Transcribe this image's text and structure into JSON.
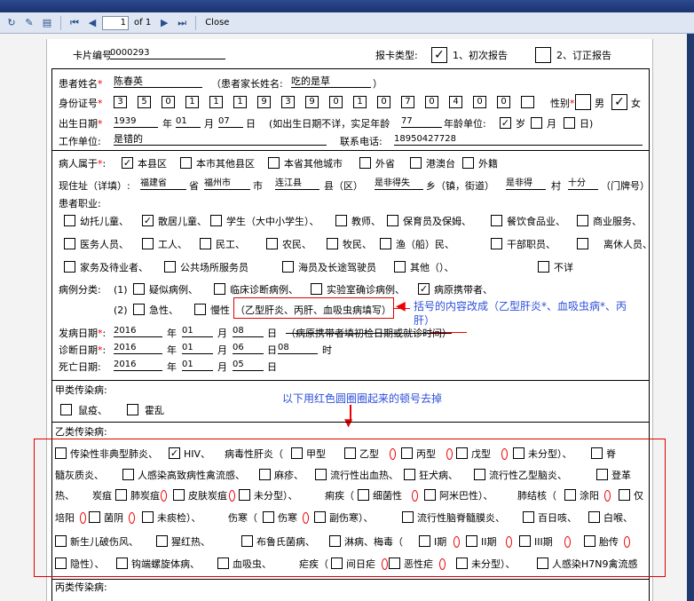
{
  "toolbar": {
    "page": "1",
    "of": "of 1",
    "close": "Close"
  },
  "header": {
    "card_no_label": "卡片编号",
    "card_no": "0000293",
    "type_label": "报卡类型:",
    "type1": "1、初次报告",
    "type2": "2、订正报告"
  },
  "patient": {
    "name_label": "患者姓名",
    "name": "陈春英",
    "parent_label": "（患者家长姓名:",
    "parent": "吃的是草",
    "parent_close": "）",
    "id_label": "身份证号",
    "id_digits": [
      "3",
      "5",
      "0",
      "1",
      "1",
      "1",
      "9",
      "3",
      "9",
      "0",
      "1",
      "0",
      "7",
      "0",
      "4",
      "0",
      "0"
    ],
    "sex_label": "性别",
    "male": "男",
    "female": "女",
    "dob_label": "出生日期",
    "dob_y": "1939",
    "dob_m": "01",
    "dob_d": "07",
    "y": "年",
    "m": "月",
    "d": "日",
    "age_note": "(如出生日期不详，实足年龄",
    "age": "77",
    "age_unit_label": "年龄单位:",
    "sui": "岁",
    "yue": "月",
    "ri": "日)",
    "work_label": "工作单位:",
    "work": "是错的",
    "tel_label": "联系电话:",
    "tel": "18950427728"
  },
  "belong": {
    "label": "病人属于",
    "opts": [
      "本县区",
      "本市其他县区",
      "本省其他城市",
      "外省",
      "港澳台",
      "外籍"
    ]
  },
  "address": {
    "label": "现住址（详填）:",
    "prov": "福建省",
    "shi": "省",
    "city": "福州市",
    "shi2": "市",
    "county": "连江县",
    "xian": "县（区）",
    "town": "是非得失",
    "xiang": "乡（镇，街道）",
    "village": "是非得",
    "cun": "村",
    "num": "十分",
    "hao": "（门牌号）"
  },
  "job": {
    "label": "患者职业:",
    "opts": [
      "幼托儿童、",
      "散居儿童、",
      "学生（大中小学生）、",
      "教师、",
      "保育员及保姆、",
      "餐饮食品业、",
      "商业服务、",
      "医务人员、",
      "工人、",
      "民工、",
      "农民、",
      "牧民、",
      "渔（船）民、",
      "干部职员、",
      "离休人员、",
      "家务及待业者、",
      "公共场所服务员",
      "海员及长途驾驶员",
      "其他（）、",
      "不详"
    ]
  },
  "cls": {
    "label": "病例分类:",
    "p1": "(1)",
    "opts1": [
      "疑似病例、",
      "临床诊断病例、",
      "实验室确诊病例、",
      "病原携带者、"
    ],
    "p2": "(2)",
    "acute": "急性、",
    "chronic": "慢性",
    "note": "（乙型肝炎、丙肝、血吸虫病填写）"
  },
  "dates": {
    "onset_label": "发病日期",
    "onset": [
      "2016",
      "01",
      "08"
    ],
    "onset_note": "（病原携带者填初检日期或就诊时间）",
    "diag_label": "诊断日期",
    "diag": [
      "2016",
      "01",
      "06",
      "08"
    ],
    "shi": "时",
    "death_label": "死亡日期:",
    "death": [
      "2016",
      "01",
      "05"
    ]
  },
  "annotations": {
    "a1": "括号的内容改成（乙型肝炎*、血吸虫病*、丙",
    "a1b": "肝）",
    "a2": "以下用红色圆圈圈起来的顿号去掉"
  },
  "classA": {
    "label": "甲类传染病:",
    "opts": [
      "鼠疫、",
      "霍乱"
    ]
  },
  "classB": {
    "label": "乙类传染病:",
    "row1": [
      "传染性非典型肺炎、",
      "HIV、",
      "病毒性肝炎（",
      "甲型",
      "乙型",
      "丙型",
      "戊型",
      "未分型）、",
      "脊"
    ],
    "row2": [
      "髓灰质炎、",
      "人感染高致病性禽流感、",
      "麻疹、",
      "流行性出血热、",
      "狂犬病、",
      "流行性乙型脑炎、",
      "登革"
    ],
    "row3": [
      "热、",
      "炭疽（",
      "肺炭疽",
      "皮肤炭疽",
      "未分型）、",
      "痢疾（",
      "细菌性",
      "阿米巴性）、",
      "肺结核（",
      "涂阳",
      "仅"
    ],
    "row4": [
      "培阳",
      "菌阴",
      "未痰检）、",
      "伤寒（",
      "伤寒",
      "副伤寒）、",
      "流行性脑脊髓膜炎、",
      "百日咳、",
      "白喉、"
    ],
    "row5": [
      "新生儿破伤风、",
      "猩红热、",
      "布鲁氏菌病、",
      "淋病、梅毒（",
      "I期",
      "II期",
      "III期",
      "胎传"
    ],
    "row6": [
      "隐性）、",
      "钩端螺旋体病、",
      "血吸虫、",
      "疟疾（",
      "间日疟",
      "恶性疟",
      "未分型）、",
      "人感染H7N9禽流感"
    ]
  },
  "classC": {
    "label": "丙类传染病:"
  },
  "colors": {
    "accent_red": "#e00000",
    "annotation_blue": "#2b4fd9"
  }
}
